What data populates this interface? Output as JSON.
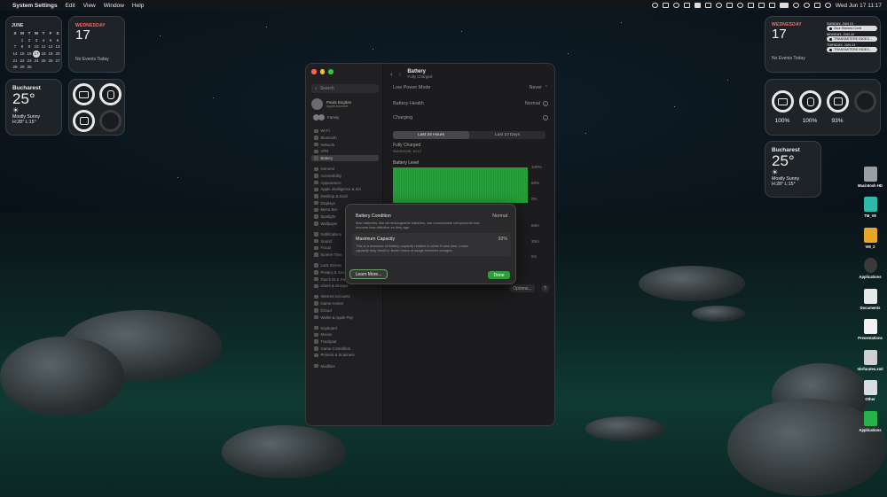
{
  "menubar": {
    "app_name": "System Settings",
    "menus": [
      "Edit",
      "View",
      "Window",
      "Help"
    ],
    "datetime": "Wed Jun 17  11:17"
  },
  "calendar_widget": {
    "month": "JUNE",
    "weekdays": [
      "S",
      "M",
      "T",
      "W",
      "T",
      "F",
      "S"
    ],
    "days": [
      "",
      "1",
      "2",
      "3",
      "4",
      "5",
      "6",
      "7",
      "8",
      "9",
      "10",
      "11",
      "12",
      "13",
      "14",
      "15",
      "16",
      "17",
      "18",
      "19",
      "20",
      "21",
      "22",
      "23",
      "24",
      "25",
      "26",
      "27",
      "28",
      "29",
      "30",
      "",
      "",
      "",
      "",
      ""
    ],
    "today": "17"
  },
  "day_widget_left": {
    "weekday": "WEDNESDAY",
    "day": "17",
    "no_events": "No Events Today"
  },
  "weather_left": {
    "city": "Bucharest",
    "temp": "25°",
    "condition": "Mostly Sunny",
    "hilo": "H:28° L:15°"
  },
  "day_widget_right": {
    "weekday": "WEDNESDAY",
    "day": "17",
    "no_events": "No Events Today",
    "events": [
      {
        "date": "SUNDAY, JUN 21",
        "title": "Ziua Simona Conti"
      },
      {
        "date": "MONDAY, JUN 22",
        "title": "TRANSMITERE INDEX..."
      },
      {
        "date": "TUESDAY, JUN 23",
        "title": "TRANSMITERE INDEX..."
      }
    ]
  },
  "battery_right": {
    "values": [
      "100%",
      "100%",
      "93%"
    ]
  },
  "weather_right": {
    "city": "Bucharest",
    "temp": "25°",
    "condition": "Mostly Sunny",
    "hilo": "H:28° L:15°"
  },
  "desktop_icons": [
    {
      "label": "Macintosh HD"
    },
    {
      "label": "TM_V8"
    },
    {
      "label": "VM_2"
    },
    {
      "label": "Applications"
    },
    {
      "label": "Documents"
    },
    {
      "label": "Presentations"
    },
    {
      "label": "nbrfurates.xml"
    },
    {
      "label": "Other"
    },
    {
      "label": "Applications"
    }
  ],
  "settings": {
    "search_placeholder": "Search",
    "user_name": "Paula Bogdan",
    "user_sub": "Apple Account",
    "family": "Family",
    "sidebar_items": [
      "Wi-Fi",
      "Bluetooth",
      "Network",
      "VPN",
      "Battery",
      "",
      "General",
      "Accessibility",
      "Appearance",
      "Apple Intelligence & Siri",
      "Desktop & Dock",
      "Displays",
      "Menu Bar",
      "Spotlight",
      "Wallpaper",
      "",
      "Notifications",
      "Sound",
      "Focus",
      "Screen Time",
      "",
      "Lock Screen",
      "Privacy & Security",
      "Touch ID & Password",
      "Users & Groups",
      "",
      "Internet Accounts",
      "Game Center",
      "iCloud",
      "Wallet & Apple Pay",
      "",
      "Keyboard",
      "Mouse",
      "Trackpad",
      "Game Controllers",
      "Printers & Scanners",
      "",
      "Mudfiles"
    ],
    "title": "Battery",
    "subtitle": "Fully Charged",
    "low_power_label": "Low Power Mode",
    "low_power_value": "Never",
    "health_label": "Battery Health",
    "health_value": "Normal",
    "charging_label": "Charging",
    "tab_24h": "Last 24 Hours",
    "tab_10d": "Last 10 Days",
    "status": "Fully Charged",
    "status_time": "05/09/2026, 10:17",
    "battery_level_label": "Battery Level",
    "y_ticks": [
      "100%",
      "50%",
      "0%"
    ],
    "usage_ticks": [
      "60m",
      "30m",
      "0m"
    ],
    "options_label": "Options...",
    "help_label": "?"
  },
  "dialog": {
    "condition_label": "Battery Condition",
    "condition_value": "Normal",
    "condition_desc": "Mac batteries, like all rechargeable batteries, are consumable components that become less effective as they age.",
    "capacity_label": "Maximum Capacity",
    "capacity_value": "92%",
    "capacity_desc": "This is a measure of battery capacity relative to when it was new. Lower capacity may result in fewer hours of usage between charges.",
    "learn_more": "Learn More...",
    "done": "Done"
  },
  "colors": {
    "accent_green": "#2e9e3c",
    "chart_green": "#24a33a",
    "red": "#ff5f57",
    "yellow": "#febc2e",
    "green": "#28c840"
  }
}
